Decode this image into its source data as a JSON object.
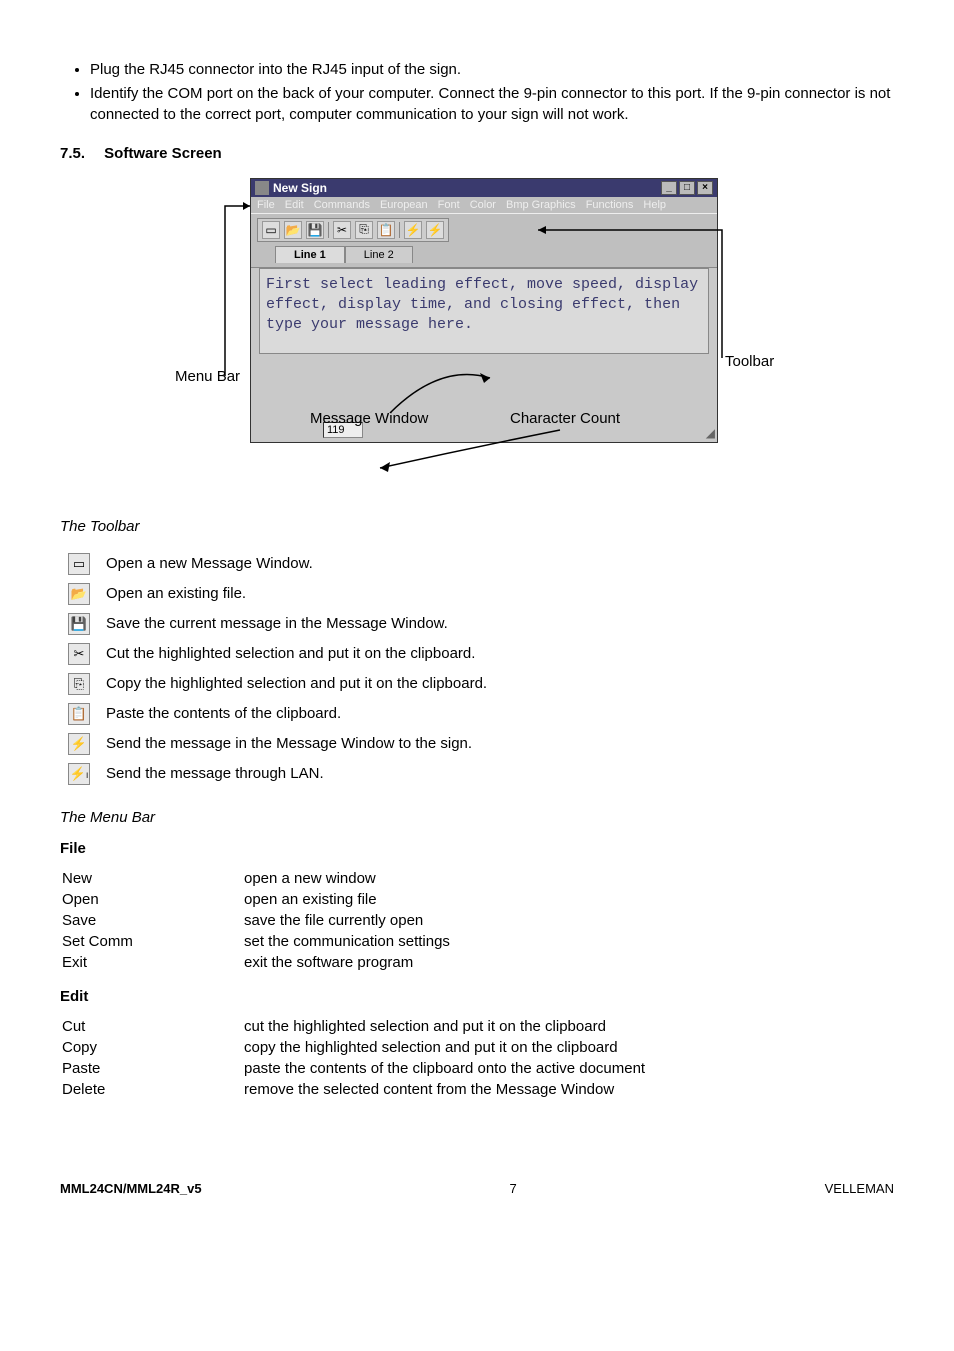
{
  "intro_bullets": [
    "Plug the RJ45 connector into the RJ45 input of the sign.",
    "Identify the COM port on the back of your computer. Connect the 9-pin connector to this port. If the 9-pin connector is not connected to the correct port, computer communication to your sign will not work."
  ],
  "section": {
    "number": "7.5.",
    "title": "Software Screen"
  },
  "app": {
    "title": "New Sign",
    "menus": [
      "File",
      "Edit",
      "Commands",
      "European",
      "Font",
      "Color",
      "Bmp Graphics",
      "Functions",
      "Help"
    ],
    "tabs": [
      "Line 1",
      "Line 2"
    ],
    "message_text": "First select leading effect, move speed, display effect, display time, and closing effect, then type your message here.",
    "char_count": "119"
  },
  "callouts": {
    "menu_bar": "Menu Bar",
    "toolbar": "Toolbar",
    "message_window": "Message Window",
    "char_count": "Character Count"
  },
  "toolbar_heading": "The Toolbar",
  "toolbar_items": [
    {
      "icon": "new-icon",
      "glyph": "▭",
      "desc": "Open a new Message Window."
    },
    {
      "icon": "open-icon",
      "glyph": "📂",
      "desc": "Open an existing file."
    },
    {
      "icon": "save-icon",
      "glyph": "💾",
      "desc": "Save the current message in the Message Window."
    },
    {
      "icon": "cut-icon",
      "glyph": "✂",
      "desc": "Cut the highlighted selection and put it on the clipboard."
    },
    {
      "icon": "copy-icon",
      "glyph": "⎘",
      "desc": "Copy the highlighted selection and put it on the clipboard."
    },
    {
      "icon": "paste-icon",
      "glyph": "📋",
      "desc": "Paste the contents of the clipboard."
    },
    {
      "icon": "send-icon",
      "glyph": "⚡",
      "desc": "Send the message in the Message Window to the sign."
    },
    {
      "icon": "send-lan-icon",
      "glyph": "⚡ₗ",
      "desc": "Send the message through LAN."
    }
  ],
  "menubar_heading": "The Menu Bar",
  "file_heading": "File",
  "file_items": [
    {
      "cmd": "New",
      "desc": "open a new window"
    },
    {
      "cmd": "Open",
      "desc": "open an existing file"
    },
    {
      "cmd": "Save",
      "desc": "save the file currently open"
    },
    {
      "cmd": "Set Comm",
      "desc": "set the communication settings"
    },
    {
      "cmd": "Exit",
      "desc": "exit the software program"
    }
  ],
  "edit_heading": "Edit",
  "edit_items": [
    {
      "cmd": "Cut",
      "desc": "cut the highlighted selection and put it on the clipboard"
    },
    {
      "cmd": "Copy",
      "desc": "copy the highlighted selection and put it on the clipboard"
    },
    {
      "cmd": "Paste",
      "desc": "paste the contents of the clipboard onto the active document"
    },
    {
      "cmd": "Delete",
      "desc": "remove the selected content from the Message Window"
    }
  ],
  "footer": {
    "left": "MML24CN/MML24R_v5",
    "center": "7",
    "right": "VELLEMAN"
  }
}
